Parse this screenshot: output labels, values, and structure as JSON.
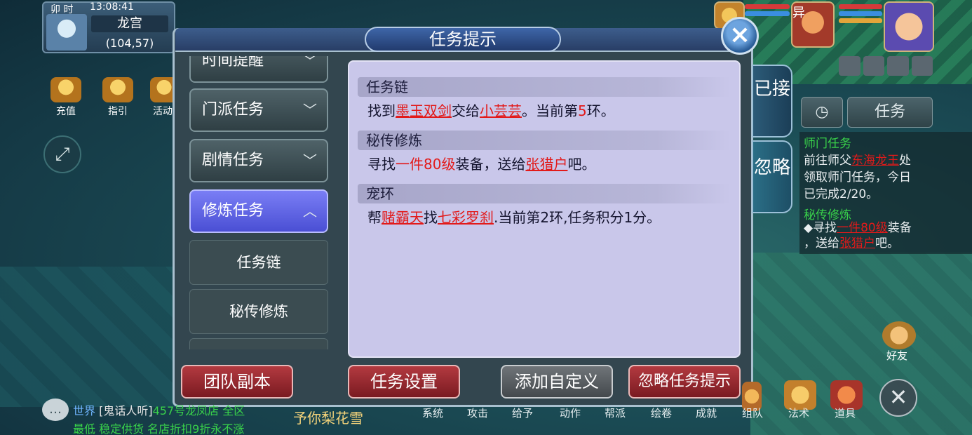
{
  "status": {
    "time_label": "卯 时",
    "clock": "13:08:41",
    "location": "龙宫",
    "coords": "(104,57)"
  },
  "shortcuts": [
    "充值",
    "指引",
    "活动"
  ],
  "dialog": {
    "title": "任务提示",
    "menu": [
      {
        "label": "时间提醒",
        "state": "collapsed"
      },
      {
        "label": "门派任务",
        "state": "collapsed"
      },
      {
        "label": "剧情任务",
        "state": "collapsed"
      },
      {
        "label": "修炼任务",
        "state": "expanded"
      }
    ],
    "submenu": [
      "任务链",
      "秘传修炼"
    ],
    "tasks": [
      {
        "title": "任务链",
        "parts": [
          {
            "t": "找到",
            "style": "plain"
          },
          {
            "t": "墨玉双剑",
            "style": "link"
          },
          {
            "t": "交给",
            "style": "plain"
          },
          {
            "t": "小芸芸",
            "style": "link"
          },
          {
            "t": "。当前第",
            "style": "plain"
          },
          {
            "t": "5",
            "style": "red"
          },
          {
            "t": "环。",
            "style": "plain"
          }
        ]
      },
      {
        "title": "秘传修炼",
        "parts": [
          {
            "t": "寻找",
            "style": "plain"
          },
          {
            "t": "一件80级",
            "style": "red"
          },
          {
            "t": "装备，送给",
            "style": "plain"
          },
          {
            "t": "张猎户",
            "style": "link"
          },
          {
            "t": "吧。",
            "style": "plain"
          }
        ]
      },
      {
        "title": "宠环",
        "parts": [
          {
            "t": "帮",
            "style": "plain"
          },
          {
            "t": "赌霸天",
            "style": "link"
          },
          {
            "t": "找",
            "style": "plain"
          },
          {
            "t": "七彩罗刹",
            "style": "link"
          },
          {
            "t": ".当前第2环,任务积分1分。",
            "style": "plain"
          }
        ]
      }
    ],
    "buttons": {
      "team_dungeon": "团队副本",
      "task_settings": "任务设置",
      "add_custom": "添加自定义",
      "ignore_tips": "忽略任务提示"
    },
    "side_tabs": {
      "accepted": "已接",
      "ignored": "忽略"
    }
  },
  "tracker": {
    "task_button": "任务",
    "sect_title": "师门任务",
    "sect_line1_a": "前往师父",
    "sect_line1_npc": "东海龙王",
    "sect_line1_b": "处",
    "sect_line2": "领取师门任务，今日",
    "sect_line3": "已完成2/20。",
    "secret_title": "秘传修炼",
    "secret_line1_a": "◆寻找",
    "secret_line1_item": "一件80级",
    "secret_line1_b": "装备",
    "secret_line2_a": "，送给",
    "secret_line2_npc": "张猎户",
    "secret_line2_b": "吧。"
  },
  "top_right": {
    "player_name_char": "异"
  },
  "right_bottom": {
    "friends": "好友"
  },
  "chat": {
    "channel": "世界",
    "speaker": "[鬼话人听]",
    "msg1": "457号龙凤店 全区",
    "msg2": "最低 稳定供货 名店折扣9折永不涨",
    "overlay": "予你梨花雪"
  },
  "bottom_bar": [
    "系统",
    "攻击",
    "给予",
    "动作",
    "帮派",
    "绘卷",
    "成就",
    "组队",
    "法术",
    "道具"
  ],
  "colors": {
    "accent_red": "#e21a1a",
    "active_tab": "#5a5fe0",
    "panel": "#c9c7ea"
  }
}
